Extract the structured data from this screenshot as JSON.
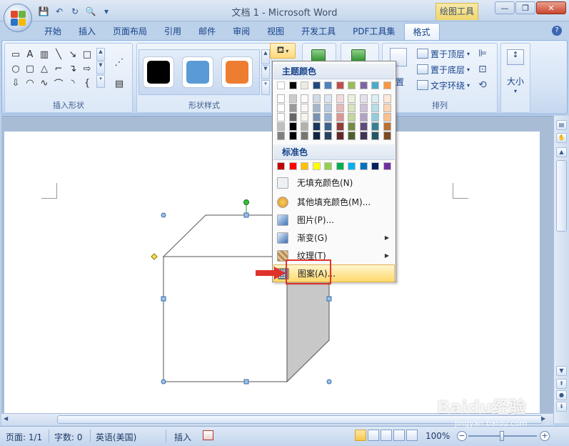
{
  "window": {
    "title": "文档 1 - Microsoft Word",
    "context_tools": "绘图工具",
    "controls": [
      "minimize-icon",
      "restore-icon",
      "close-icon"
    ]
  },
  "quick_access": [
    "save-icon",
    "undo-icon",
    "redo-icon",
    "print-preview-icon",
    "customize-icon"
  ],
  "tabs": [
    {
      "label": "开始"
    },
    {
      "label": "插入"
    },
    {
      "label": "页面布局"
    },
    {
      "label": "引用"
    },
    {
      "label": "邮件"
    },
    {
      "label": "审阅"
    },
    {
      "label": "视图"
    },
    {
      "label": "开发工具"
    },
    {
      "label": "PDF工具集"
    },
    {
      "label": "格式",
      "active": true
    }
  ],
  "ribbon": {
    "insert_shapes": {
      "label": "插入形状"
    },
    "shape_styles": {
      "label": "形状样式",
      "swatches": [
        "#000000",
        "#5b9bd5",
        "#ed7d31"
      ]
    },
    "arrange": {
      "label": "排列",
      "bring_front": "置于顶层",
      "send_back": "置于底层",
      "text_wrap": "文字环绕",
      "position_partial": "置"
    },
    "size": {
      "label": "大小"
    }
  },
  "fill_menu": {
    "theme_colors_label": "主题颜色",
    "theme_top_row": [
      "#ffffff",
      "#000000",
      "#eeece1",
      "#1f497d",
      "#4f81bd",
      "#c0504d",
      "#9bbb59",
      "#8064a2",
      "#4bacc6",
      "#f79646"
    ],
    "standard_colors_label": "标准色",
    "standard_row": [
      "#c00000",
      "#ff0000",
      "#ffc000",
      "#ffff00",
      "#92d050",
      "#00b050",
      "#00b0f0",
      "#0070c0",
      "#002060",
      "#7030a0"
    ],
    "items": [
      {
        "label": "无填充颜色(N)",
        "icon": "no-fill-icon"
      },
      {
        "label": "其他填充颜色(M)...",
        "icon": "palette-icon"
      },
      {
        "label": "图片(P)...",
        "icon": "picture-icon"
      },
      {
        "label": "渐变(G)",
        "icon": "gradient-icon",
        "submenu": true
      },
      {
        "label": "纹理(T)",
        "icon": "texture-icon",
        "submenu": true
      },
      {
        "label": "图案(A)...",
        "icon": "pattern-icon",
        "highlighted": true
      }
    ]
  },
  "status": {
    "page": "页面: 1/1",
    "words": "字数: 0",
    "language": "英语(美国)",
    "mode": "插入",
    "zoom": "100%"
  },
  "watermark": {
    "main": "Baidu经验",
    "sub": "jingyan.baidu.com"
  }
}
